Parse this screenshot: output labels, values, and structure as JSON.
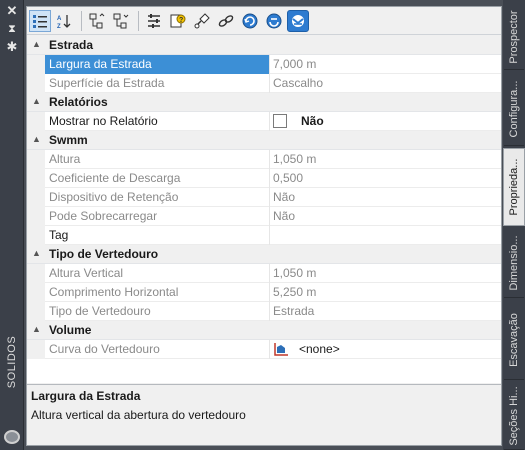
{
  "palette": {
    "title": "SOLIDOS"
  },
  "toolbar": {
    "buttons": [
      "categorized-icon",
      "sort-az-icon",
      "expand-icon",
      "collapse-icon",
      "properties-icon",
      "help-icon",
      "link-icon",
      "chain-icon",
      "refresh-icon",
      "sync-icon",
      "settings-icon"
    ]
  },
  "categories": {
    "estrada": "Estrada",
    "relatorios": "Relatórios",
    "swmm": "Swmm",
    "vertedouro": "Tipo de Vertedouro",
    "volume": "Volume"
  },
  "properties": {
    "largura": {
      "name": "Largura da Estrada",
      "value": "7,000 m"
    },
    "superficie": {
      "name": "Superfície da Estrada",
      "value": "Cascalho"
    },
    "mostrar": {
      "name": "Mostrar no Relatório",
      "value": "Não",
      "checked": false
    },
    "altura": {
      "name": "Altura",
      "value": "1,050 m"
    },
    "coeficiente": {
      "name": "Coeficiente de Descarga",
      "value": "0,500"
    },
    "dispositivo": {
      "name": "Dispositivo de Retenção",
      "value": "Não"
    },
    "sobrecarregar": {
      "name": "Pode Sobrecarregar",
      "value": "Não"
    },
    "tag": {
      "name": "Tag",
      "value": ""
    },
    "altura_vertical": {
      "name": "Altura Vertical",
      "value": "1,050 m"
    },
    "comprimento": {
      "name": "Comprimento Horizontal",
      "value": "5,250 m"
    },
    "tipo": {
      "name": "Tipo de Vertedouro",
      "value": "Estrada"
    },
    "curva": {
      "name": "Curva do Vertedouro",
      "value": "<none>"
    }
  },
  "description": {
    "title": "Largura da Estrada",
    "text": "Altura vertical da abertura do vertedouro"
  },
  "tabs": [
    "Prospector",
    "Configura...",
    "Proprieda...",
    "Dimensio...",
    "Escavação",
    "Seções Hi..."
  ],
  "colors": {
    "selection": "#3c8fd6",
    "accent": "#2d7bd0"
  }
}
